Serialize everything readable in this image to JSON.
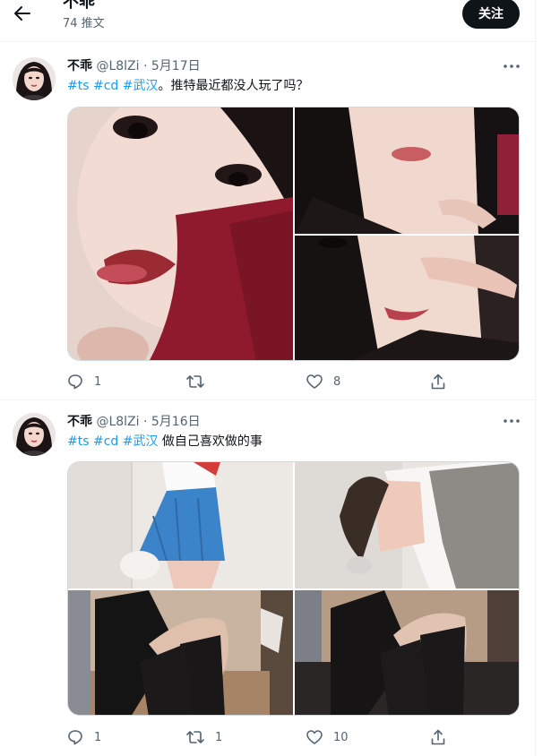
{
  "header": {
    "title": "不乖",
    "tweet_count": "74 推文",
    "follow_label": "关注"
  },
  "icons": {
    "back": "arrow-left-icon",
    "more": "more-horizontal-icon",
    "reply": "reply-icon",
    "retweet": "retweet-icon",
    "like": "heart-icon",
    "share": "share-icon"
  },
  "colors": {
    "link": "#1d9bf0",
    "text": "#0f1419",
    "secondary": "#536471",
    "follow_bg": "#0f1419"
  },
  "tweets": [
    {
      "user": "不乖",
      "handle": "@L8lZi",
      "dot": "·",
      "date": "5月17日",
      "hashtags": [
        "#ts",
        "#cd",
        "#武汉"
      ],
      "body": "。推特最近都没人玩了吗？",
      "replies": "1",
      "retweets": "",
      "likes": "8"
    },
    {
      "user": "不乖",
      "handle": "@L8lZi",
      "dot": "·",
      "date": "5月16日",
      "hashtags": [
        "#ts",
        "#cd",
        "#武汉"
      ],
      "body": " 做自己喜欢做的事",
      "replies": "1",
      "retweets": "1",
      "likes": "10"
    }
  ]
}
